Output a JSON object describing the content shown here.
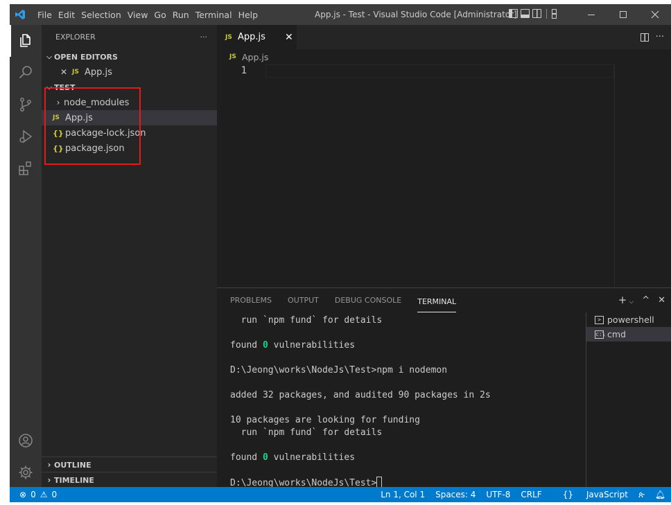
{
  "titlebar": {
    "menu": [
      "File",
      "Edit",
      "Selection",
      "View",
      "Go",
      "Run",
      "Terminal",
      "Help"
    ],
    "title": "App.js - Test - Visual Studio Code [Administrator]"
  },
  "explorer": {
    "header": "EXPLORER",
    "more": "···",
    "open_editors": {
      "label": "OPEN EDITORS",
      "items": [
        {
          "badge": "JS",
          "name": "App.js"
        }
      ]
    },
    "folder": {
      "label": "TEST",
      "items": [
        {
          "badge": "",
          "name": "node_modules",
          "type": "folder"
        },
        {
          "badge": "JS",
          "name": "App.js",
          "type": "file"
        },
        {
          "badge": "{}",
          "name": "package-lock.json",
          "type": "file"
        },
        {
          "badge": "{}",
          "name": "package.json",
          "type": "file"
        }
      ]
    },
    "outline": "OUTLINE",
    "timeline": "TIMELINE"
  },
  "editor": {
    "tab": {
      "badge": "JS",
      "label": "App.js"
    },
    "breadcrumb": {
      "badge": "JS",
      "label": "App.js"
    },
    "line_number": "1",
    "more": "···"
  },
  "panel": {
    "tabs": [
      "PROBLEMS",
      "OUTPUT",
      "DEBUG CONSOLE",
      "TERMINAL"
    ],
    "active_tab": "TERMINAL",
    "terminal_lines": [
      "  run `npm fund` for details",
      "",
      "found 0 vulnerabilities",
      "",
      "D:\\Jeong\\works\\NodeJs\\Test>npm i nodemon",
      "",
      "added 32 packages, and audited 90 packages in 2s",
      "",
      "10 packages are looking for funding",
      "  run `npm fund` for details",
      "",
      "found 0 vulnerabilities",
      "",
      "D:\\Jeong\\works\\NodeJs\\Test>"
    ],
    "terminals": [
      {
        "icon": ">",
        "name": "powershell"
      },
      {
        "icon": "c:\\",
        "name": "cmd"
      }
    ]
  },
  "statusbar": {
    "errors": "0",
    "warnings": "0",
    "position": "Ln 1, Col 1",
    "spaces": "Spaces: 4",
    "encoding": "UTF-8",
    "eol": "CRLF",
    "language_badge": "{}",
    "language": "JavaScript"
  },
  "colors": {
    "accent": "#007acc",
    "highlight_box": "#e51919",
    "js_badge": "#cbcb41",
    "terminal_number": "#23d18b"
  }
}
